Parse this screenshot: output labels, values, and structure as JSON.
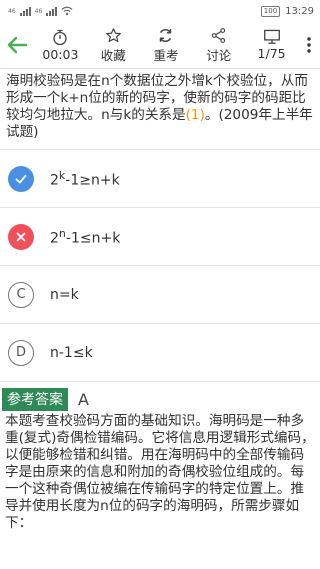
{
  "status": {
    "left_tags": [
      "46",
      "HD",
      "46",
      "HD"
    ],
    "battery": "100",
    "time": "13:29"
  },
  "toolbar": {
    "timer": "00:03",
    "favorite": "收藏",
    "retry": "重考",
    "discuss": "讨论",
    "progress": "1/75"
  },
  "question": {
    "text_before": "海明校验码是在n个数据位之外增k个校验位，从而形成一个k+n位的新的码字，使新的码字的码距比较均匀地拉大。n与k的关系是",
    "answer_mark": "(1)",
    "text_after": "。(2009年上半年试题)"
  },
  "options": [
    {
      "letter": "A",
      "base": "2",
      "exp": "k",
      "rest": "-1≥n+k",
      "state": "correct"
    },
    {
      "letter": "B",
      "base": "2",
      "exp": "n",
      "rest": "-1≤n+k",
      "state": "wrong"
    },
    {
      "letter": "C",
      "text": "n=k",
      "state": "none"
    },
    {
      "letter": "D",
      "text": "n-1≤k",
      "state": "none"
    }
  ],
  "answer": {
    "label": "参考答案",
    "value": "A",
    "explanation": "本题考查校验码方面的基础知识。海明码是一种多重(复式)奇偶检错编码。它将信息用逻辑形式编码，以便能够检错和纠错。用在海明码中的全部传输码字是由原来的信息和附加的奇偶校验位组成的。每一个这种奇偶位被编在传输码字的特定位置上。推导并使用长度为n位的码字的海明码，所需步骤如下："
  },
  "colors": {
    "back_arrow": "#4caf50",
    "correct": "#4a90e2",
    "wrong": "#f0505a",
    "answer_mark": "#ff9a00",
    "answer_label_bg": "#2e8b57"
  }
}
